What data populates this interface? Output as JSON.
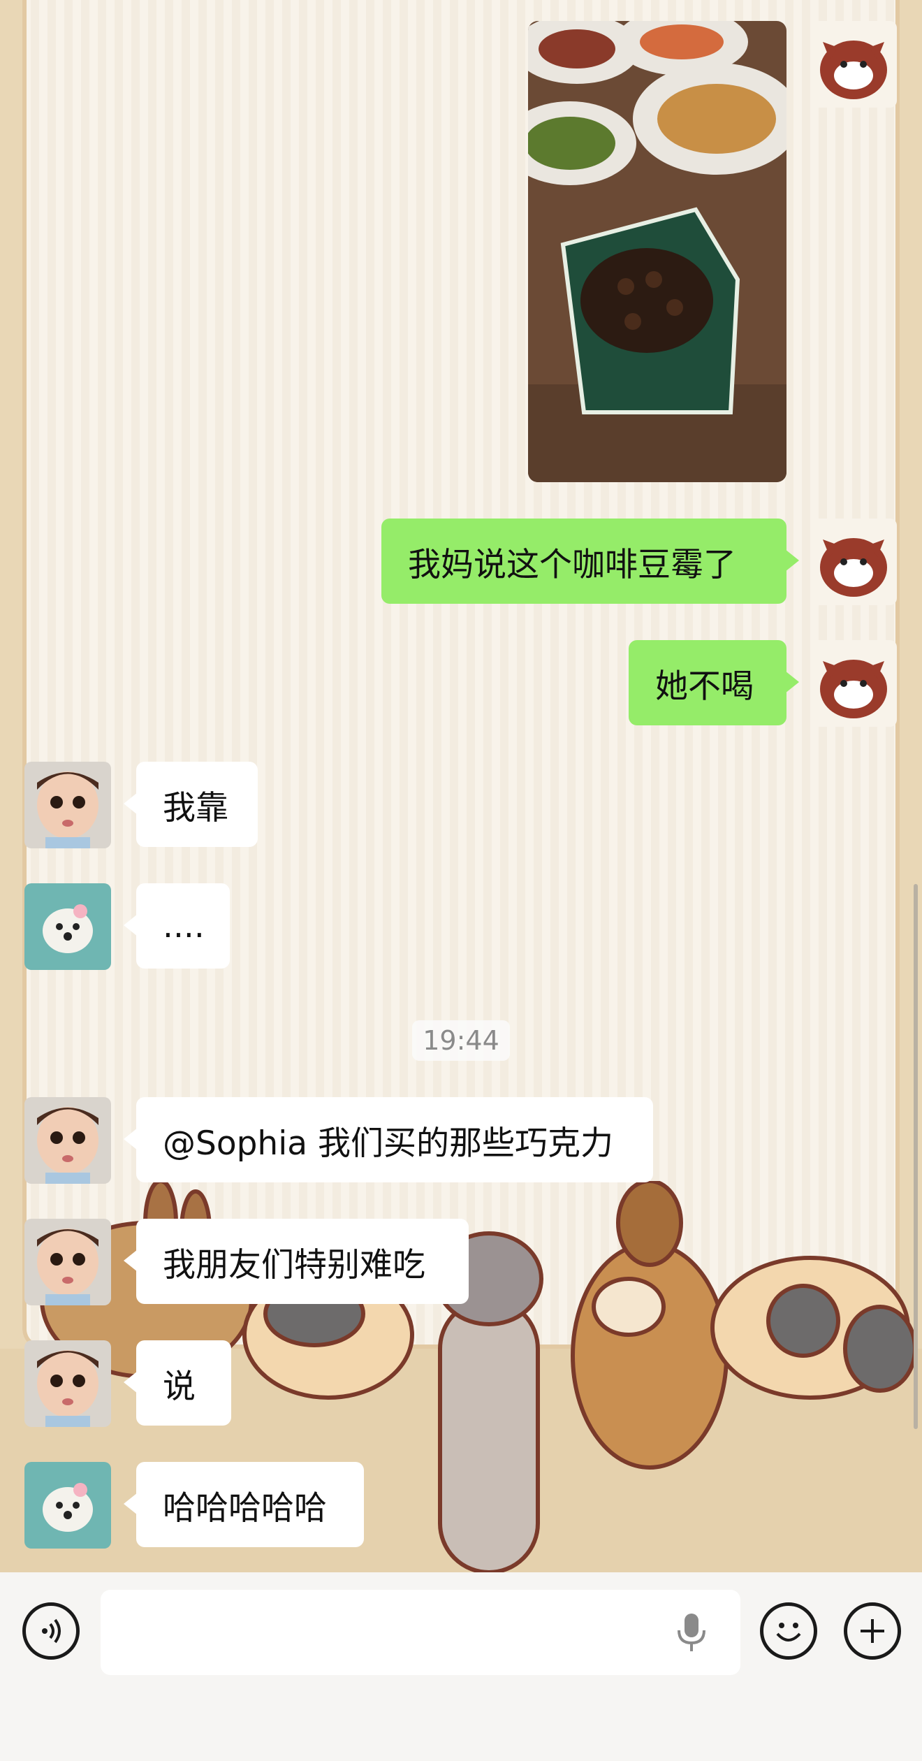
{
  "chat": {
    "timestamp": "19:44",
    "messages": [
      {
        "side": "right",
        "type": "image",
        "alt_icon": "photo-coffee-beans"
      },
      {
        "side": "right",
        "type": "text",
        "text": "我妈说这个咖啡豆霉了"
      },
      {
        "side": "right",
        "type": "text",
        "text": "她不喝"
      },
      {
        "side": "left",
        "sender_avatar": "baby-avatar",
        "type": "text",
        "text": "我靠"
      },
      {
        "side": "left",
        "sender_avatar": "dog-avatar",
        "type": "text",
        "text": "...."
      },
      {
        "side": "left",
        "sender_avatar": "baby-avatar",
        "type": "text",
        "text": "@Sophia 我们买的那些巧克力"
      },
      {
        "side": "left",
        "sender_avatar": "baby-avatar",
        "type": "text",
        "text": "我朋友们特别难吃"
      },
      {
        "side": "left",
        "sender_avatar": "baby-avatar",
        "type": "text",
        "text": "说"
      },
      {
        "side": "left",
        "sender_avatar": "dog-avatar",
        "type": "text",
        "text": "哈哈哈哈哈"
      }
    ]
  },
  "input_bar": {
    "voice_icon": "voice-mode-icon",
    "input_value": "",
    "mic_icon": "microphone-icon",
    "emoji_icon": "emoji-icon",
    "plus_icon": "plus-icon"
  },
  "colors": {
    "sent_bubble": "#95ec69",
    "received_bubble": "#ffffff",
    "wallpaper": "#f8f3ea"
  }
}
